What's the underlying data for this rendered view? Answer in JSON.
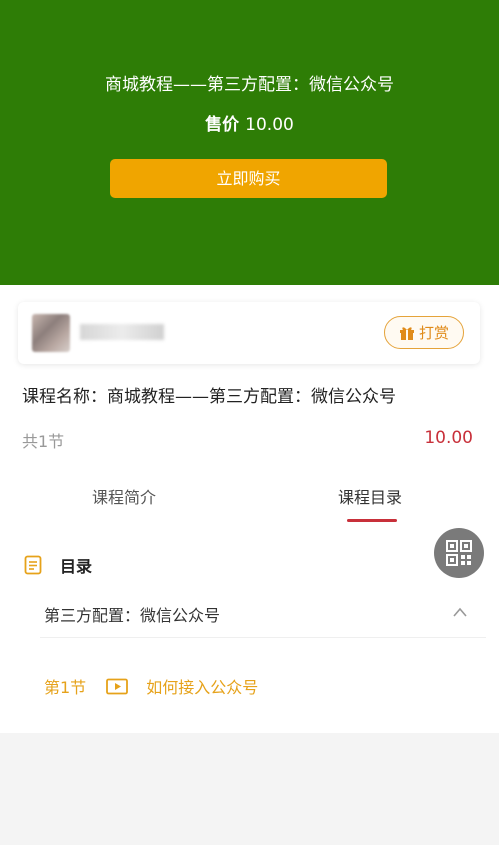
{
  "hero": {
    "title": "商城教程——第三方配置：微信公众号",
    "price_label": "售价",
    "price_value": "10.00",
    "buy_button": "立即购买",
    "bg_color": "#2e7d06",
    "button_color": "#f0a500"
  },
  "author": {
    "reward_label": "打赏",
    "reward_icon": "gift-icon"
  },
  "course": {
    "name": "课程名称：商城教程——第三方配置：微信公众号",
    "lesson_count": "共1节",
    "price": "10.00",
    "price_color": "#c8303a"
  },
  "tabs": [
    {
      "label": "课程简介",
      "active": false
    },
    {
      "label": "课程目录",
      "active": true
    }
  ],
  "qr_icon": "qr-code-icon",
  "catalog": {
    "title": "目录",
    "chapters": [
      {
        "name": "第三方配置：微信公众号",
        "expanded": true,
        "lessons": [
          {
            "number": "第1节",
            "title": "如何接入公众号",
            "icon": "play-video-icon"
          }
        ]
      }
    ]
  }
}
